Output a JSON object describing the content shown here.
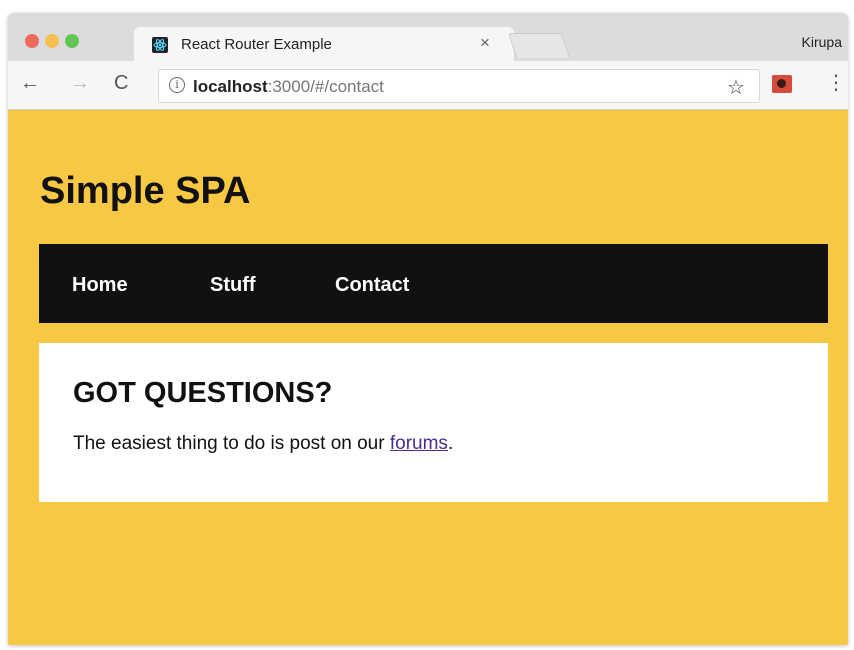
{
  "browser": {
    "tab_title": "React Router Example",
    "tab_close": "×",
    "profile_name": "Kirupa",
    "url_host": "localhost",
    "url_rest": ":3000/#/contact",
    "back_icon": "←",
    "forward_icon": "→",
    "reload_icon": "C",
    "info_icon": "i",
    "star_icon": "☆",
    "menu_icon": "⋮"
  },
  "page": {
    "title": "Simple SPA",
    "nav": [
      {
        "label": "Home"
      },
      {
        "label": "Stuff"
      },
      {
        "label": "Contact"
      }
    ],
    "content": {
      "heading": "GOT QUESTIONS?",
      "text_before": "The easiest thing to do is post on our ",
      "link_text": "forums",
      "text_after": "."
    }
  },
  "colors": {
    "page_background": "#f7c843",
    "nav_background": "#111111",
    "link_color": "#4b2c8a"
  }
}
